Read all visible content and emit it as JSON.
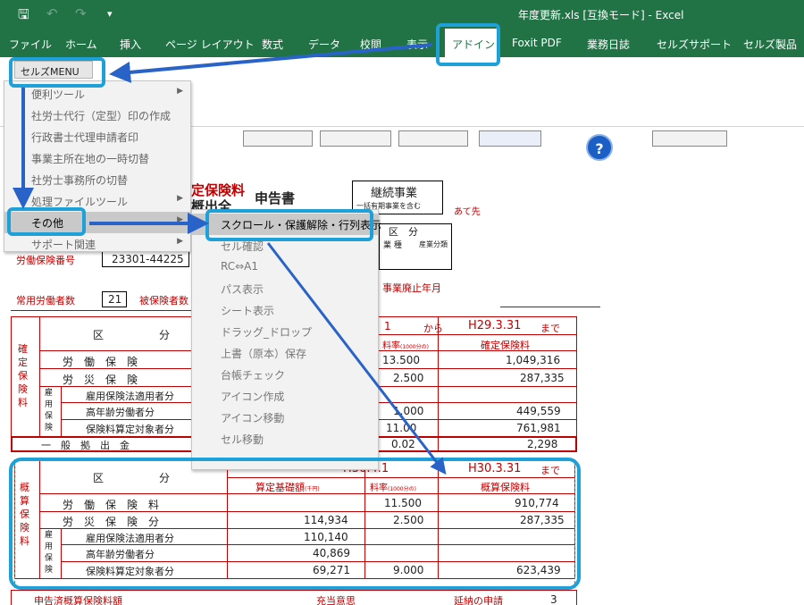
{
  "window": {
    "title": "年度更新.xls [互換モード] - Excel",
    "qa_save": "🖫",
    "qa_undo": "↶",
    "qa_redo": "↷",
    "qa_more": "▾"
  },
  "tabs": [
    "ファイル",
    "ホーム",
    "挿入",
    "ページ レイアウト",
    "数式",
    "データ",
    "校閲",
    "表示",
    "アドイン",
    "Foxit PDF",
    "業務日誌",
    "セルズサポート",
    "セルズ製品"
  ],
  "active_tab": "アドイン",
  "ribbon": {
    "menu_label": "セルズMENU ▾"
  },
  "menu": {
    "items": [
      {
        "label": "便利ツール",
        "sub": true
      },
      {
        "label": "社労士代行（定型）印の作成",
        "sub": false
      },
      {
        "label": "行政書士代理申請者印",
        "sub": false
      },
      {
        "label": "事業主所在地の一時切替",
        "sub": false
      },
      {
        "label": "社労士事務所の切替",
        "sub": false
      },
      {
        "label": "処理ファイルツール",
        "sub": true
      },
      {
        "label": "その他",
        "sub": true
      },
      {
        "label": "サポート関連",
        "sub": true
      }
    ],
    "submenu": [
      "スクロール・保護解除・行列表示",
      "セル確認",
      "RC⇔A1",
      "パス表示",
      "シート表示",
      "ドラッグ_ドロップ",
      "上書（原本）保存",
      "台帳チェック",
      "アイコン作成",
      "アイコン移動",
      "セル移動"
    ]
  },
  "sheet": {
    "title_a": "定保険料",
    "title_b": "概出全",
    "title_c": "申告書",
    "keizoku": "継続事業",
    "keizoku_sub": "一括有期事業を含む",
    "atesaki": "あて先",
    "kubun": "区　分",
    "gyoshu": "業 種",
    "sangyo": "産業分類",
    "labor_no_label": "労働保険番号",
    "labor_no": "23301-44225",
    "emp_label": "常用労働者数",
    "emp_count": "21",
    "insured_label": "被保険者数",
    "haishi": "事業廃止年月",
    "period_from_1": "1",
    "kara": "から",
    "period_end_1": "H29.3.31",
    "made": "まで",
    "kakutei_side": "確定保険料",
    "ku": "区",
    "bun": "分",
    "rate_head": "料率",
    "rate_unit": "(1000分の)",
    "kakutei_head": "確定保険料",
    "rows1": [
      {
        "label": "労　働　保　険",
        "rate": "13.500",
        "amount": "1,049,316"
      },
      {
        "label": "労　災　保　険",
        "rate": "2.500",
        "amount": "287,335"
      },
      {
        "label": "雇用保険法適用者分",
        "rate": "",
        "amount": ""
      },
      {
        "label": "高年齢労働者分",
        "rate": "1.000",
        "amount": "449,559"
      },
      {
        "label": "保険料算定対象者分",
        "rate": "11.00",
        "amount": "761,981"
      }
    ],
    "koyo_side": "雇用保険",
    "ippan": "一　般　拠　出　金",
    "ippan_rate": "0.02",
    "ippan_amount": "2,298",
    "period_start_2": "H30.4.1",
    "period_end_2": "H30.3.31",
    "gaisan_side": "概算保険料",
    "base_head": "算定基礎額",
    "base_unit": "(千円)",
    "gaisan_head": "概算保険料",
    "rows2": [
      {
        "label": "労　働　保　険　料",
        "base": "",
        "rate": "11.500",
        "amount": "910,774"
      },
      {
        "label": "労　災　保　険　分",
        "base": "114,934",
        "rate": "2.500",
        "amount": "287,335"
      },
      {
        "label": "雇用保険法適用者分",
        "base": "110,140",
        "rate": "",
        "amount": ""
      },
      {
        "label": "高年齢労働者分",
        "base": "40,869",
        "rate": "",
        "amount": ""
      },
      {
        "label": "保険料算定対象者分",
        "base": "69,271",
        "rate": "9.000",
        "amount": "623,439"
      }
    ],
    "bottom_a": "申告済概算保険料額",
    "bottom_b": "充当意思",
    "bottom_c": "延納の申請",
    "bottom_num": "3"
  },
  "colors": {
    "excel_green": "#217346",
    "highlight": "#1ea0d8",
    "arrow": "#2a63c8",
    "sheet_red": "#c00000"
  }
}
